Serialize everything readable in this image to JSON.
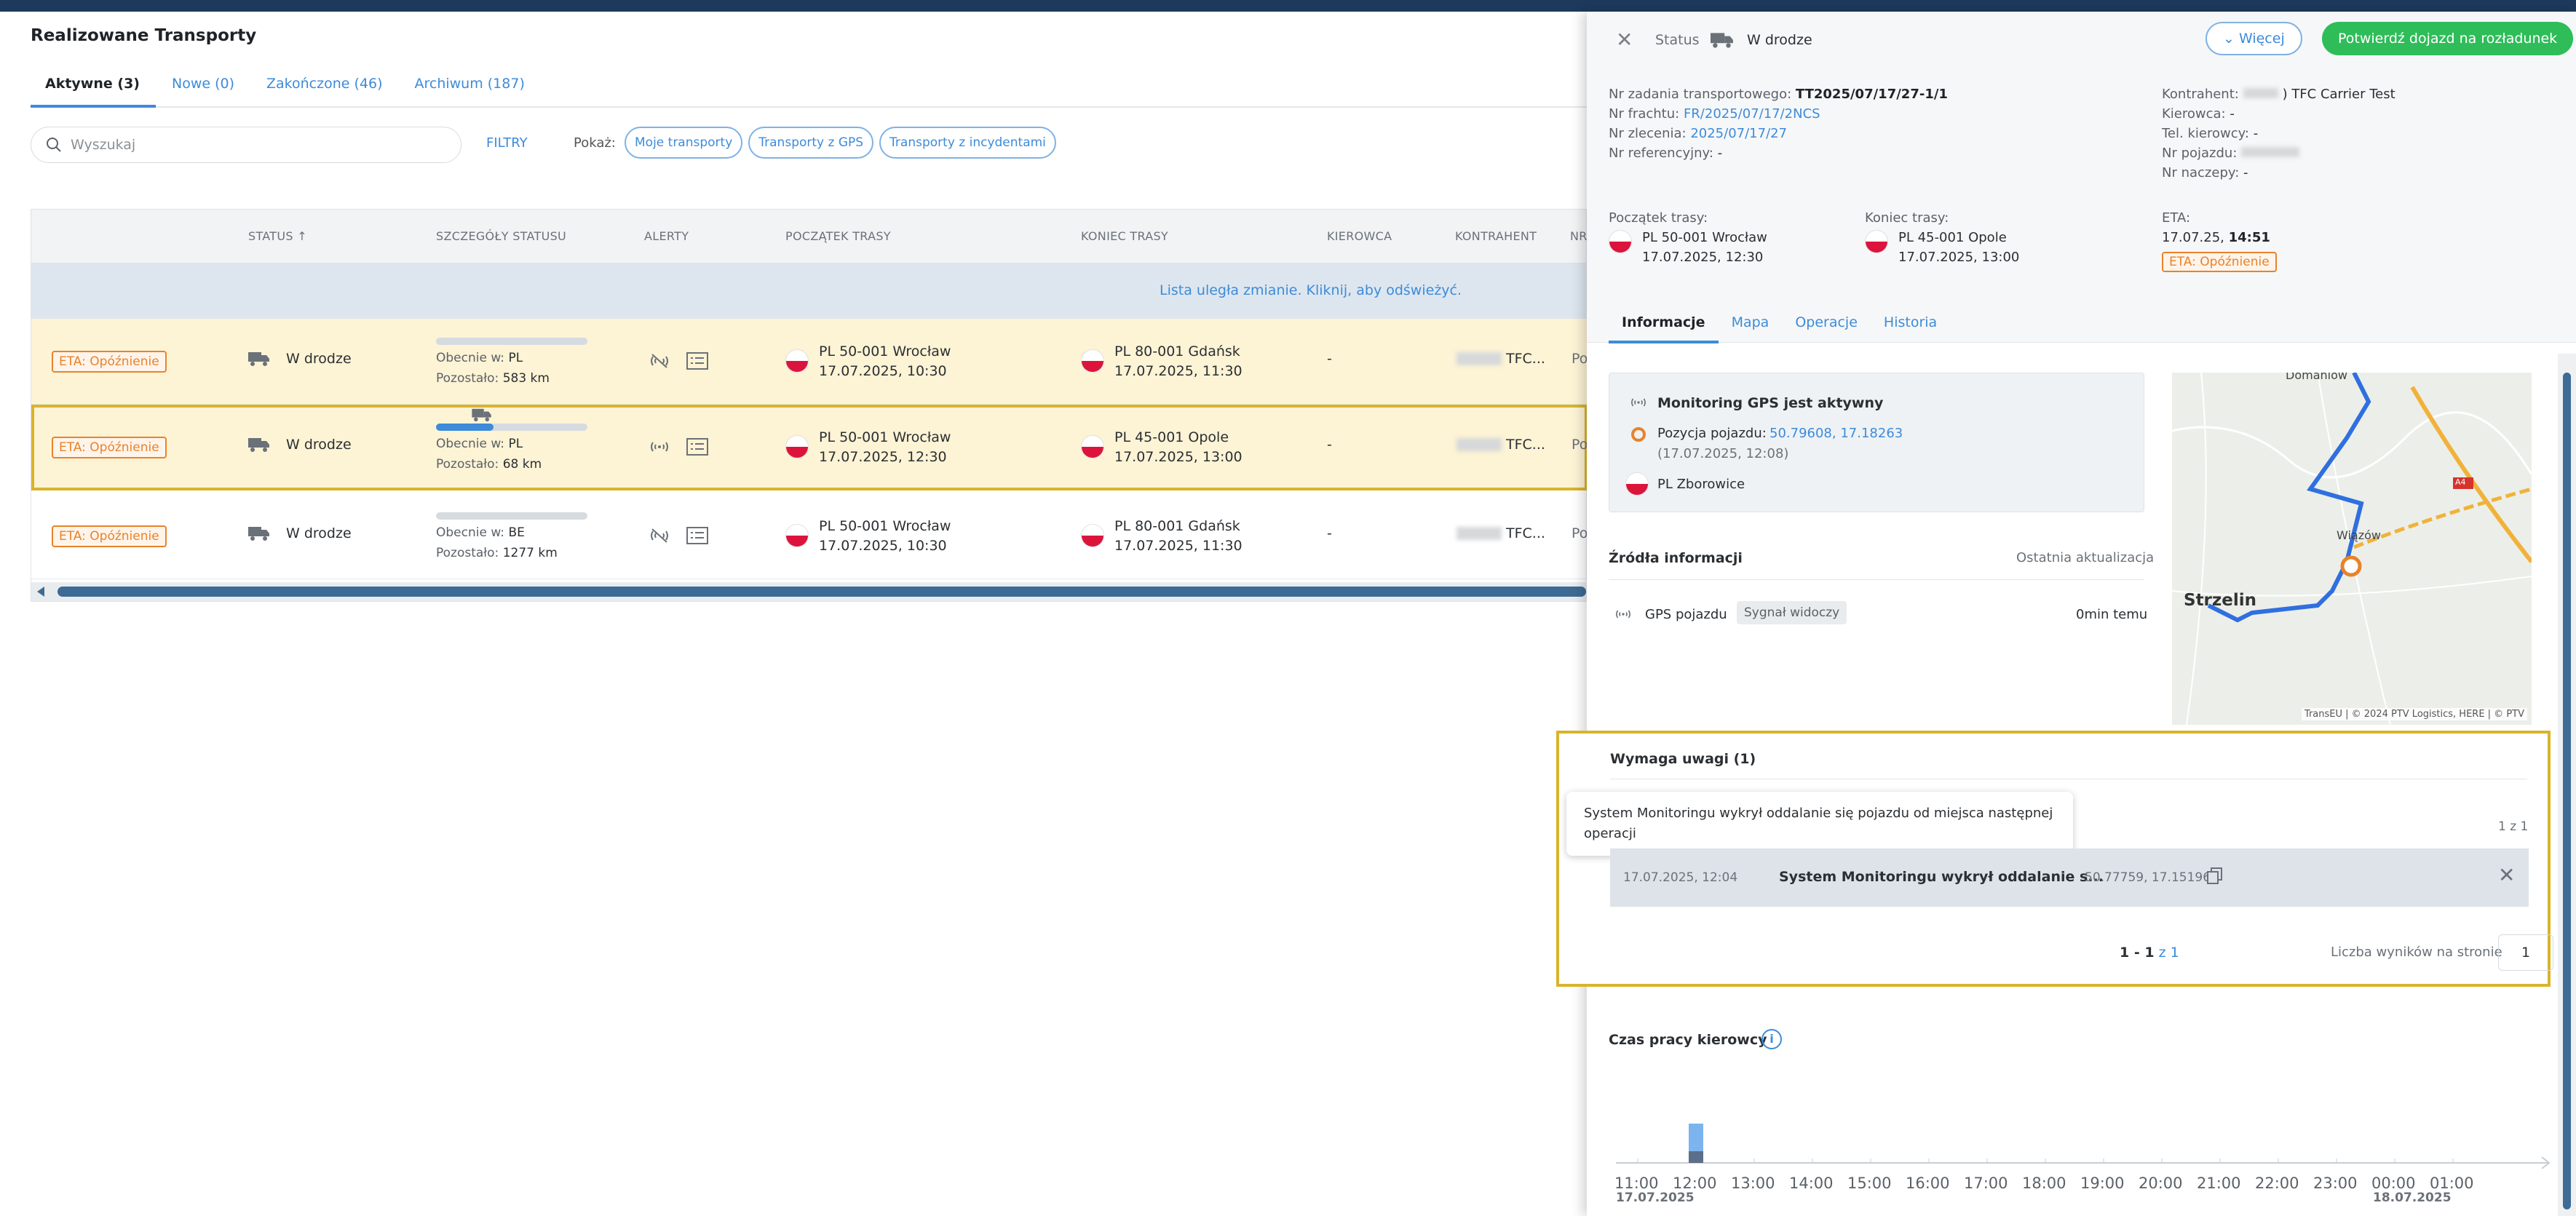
{
  "page": {
    "title": "Realizowane Transporty",
    "tabs": [
      {
        "label": "Aktywne (3)"
      },
      {
        "label": "Nowe (0)"
      },
      {
        "label": "Zakończone (46)"
      },
      {
        "label": "Archiwum (187)"
      }
    ],
    "search_placeholder": "Wyszukaj",
    "filters_label": "FILTRY",
    "show_label": "Pokaż:",
    "chips": [
      "Moje transporty",
      "Transporty z GPS",
      "Transporty z incydentami"
    ]
  },
  "table": {
    "columns": [
      "STATUS",
      "SZCZEGÓŁY STATUSU",
      "ALERTY",
      "POCZĄTEK TRASY",
      "KONIEC TRASY",
      "KIEROWCA",
      "KONTRAHENT",
      "NR"
    ],
    "refresh_notice": "Lista uległa zmianie. Kliknij, aby odświeżyć.",
    "rows": [
      {
        "badge": "ETA: Opóźnienie",
        "status": "W drodze",
        "current_label": "Obecnie w:",
        "current": "PL",
        "remaining_label": "Pozostało:",
        "remaining": "583 km",
        "progress": 0,
        "start_place": "PL 50-001 Wrocław",
        "start_time": "17.07.2025, 10:30",
        "end_place": "PL 80-001 Gdańsk",
        "end_time": "17.07.2025, 11:30",
        "driver": "-",
        "contractor": "TFC...",
        "nr": "Po"
      },
      {
        "badge": "ETA: Opóźnienie",
        "status": "W drodze",
        "current_label": "Obecnie w:",
        "current": "PL",
        "remaining_label": "Pozostało:",
        "remaining": "68 km",
        "progress": 0.38,
        "start_place": "PL 50-001 Wrocław",
        "start_time": "17.07.2025, 12:30",
        "end_place": "PL 45-001 Opole",
        "end_time": "17.07.2025, 13:00",
        "driver": "-",
        "contractor": "TFC...",
        "nr": "Po"
      },
      {
        "badge": "ETA: Opóźnienie",
        "status": "W drodze",
        "current_label": "Obecnie w:",
        "current": "BE",
        "remaining_label": "Pozostało:",
        "remaining": "1277 km",
        "progress": 0,
        "start_place": "PL 50-001 Wrocław",
        "start_time": "17.07.2025, 10:30",
        "end_place": "PL 80-001 Gdańsk",
        "end_time": "17.07.2025, 11:30",
        "driver": "-",
        "contractor": "TFC...",
        "nr": "Po"
      }
    ]
  },
  "panel": {
    "status_label": "Status",
    "status_value": "W drodze",
    "more_button": "Więcej",
    "confirm_button": "Potwierdź dojazd na rozładunek",
    "left_info": [
      {
        "label": "Nr zadania transportowego:",
        "value": "TT2025/07/17/27-1/1",
        "style": "strong"
      },
      {
        "label": "Nr frachtu:",
        "value": "FR/2025/07/17/2NCS",
        "style": "link"
      },
      {
        "label": "Nr zlecenia:",
        "value": "2025/07/17/27",
        "style": "link"
      },
      {
        "label": "Nr referencyjny:",
        "value": "-",
        "style": "v"
      }
    ],
    "right_info": [
      {
        "label": "Kontrahent:",
        "value": ") TFC Carrier Test",
        "blurred": true
      },
      {
        "label": "Kierowca:",
        "value": "-",
        "blurred": false
      },
      {
        "label": "Tel. kierowcy:",
        "value": "-",
        "blurred": false
      },
      {
        "label": "Nr pojazdu:",
        "value": "",
        "blurred": true
      },
      {
        "label": "Nr naczepy:",
        "value": "-",
        "blurred": false
      }
    ],
    "route_start_label": "Początek trasy:",
    "route_start_place": "PL 50-001 Wrocław",
    "route_start_time": "17.07.2025, 12:30",
    "route_end_label": "Koniec trasy:",
    "route_end_place": "PL 45-001 Opole",
    "route_end_time": "17.07.2025, 13:00",
    "eta_label": "ETA:",
    "eta_date": "17.07.25,",
    "eta_time": "14:51",
    "eta_badge": "ETA: Opóźnienie",
    "tabs": [
      "Informacje",
      "Mapa",
      "Operacje",
      "Historia"
    ],
    "gps": {
      "title": "Monitoring GPS jest aktywny",
      "position_label": "Pozycja pojazdu:",
      "position": "50.79608, 17.18263",
      "position_time": "(17.07.2025, 12:08)",
      "place": "PL Zborowice"
    },
    "map": {
      "labels": [
        "Domaniów",
        "Wiązów",
        "Strzelin",
        "A4"
      ],
      "attribution": "TransEU | © 2024 PTV Logistics, HERE | © PTV"
    },
    "sources": {
      "title": "Źródła informacji",
      "last_update_label": "Ostatnia aktualizacja",
      "source": "GPS pojazdu",
      "signal": "Sygnał widoczy",
      "ago": "0min temu"
    },
    "attention": {
      "title": "Wymaga uwagi (1)",
      "tooltip": "System Monitoringu wykrył oddalanie się pojazdu od miejsca następnej operacji",
      "count": "1 z 1",
      "alert_time": "17.07.2025, 12:04",
      "alert_text": "System Monitoringu wykrył oddalanie s...",
      "alert_coords": "50.77759, 17.15196",
      "pager_range": "1 - 1",
      "pager_total": "z 1",
      "per_page_label": "Liczba wyników na stronie",
      "per_page_value": "1"
    },
    "driver_time": {
      "title": "Czas pracy kierowcy",
      "hours": [
        "11:00",
        "12:00",
        "13:00",
        "14:00",
        "15:00",
        "16:00",
        "17:00",
        "18:00",
        "19:00",
        "20:00",
        "21:00",
        "22:00",
        "23:00",
        "00:00",
        "01:00"
      ],
      "date_start": "17.07.2025",
      "date_end": "18.07.2025",
      "activity_hour": 1.0
    }
  },
  "colors": {
    "accent": "#3d8bd9",
    "warning": "#e8832a",
    "highlight_row": "#fdf3d5",
    "selection": "#d9b42b",
    "confirm": "#2ebd59"
  }
}
